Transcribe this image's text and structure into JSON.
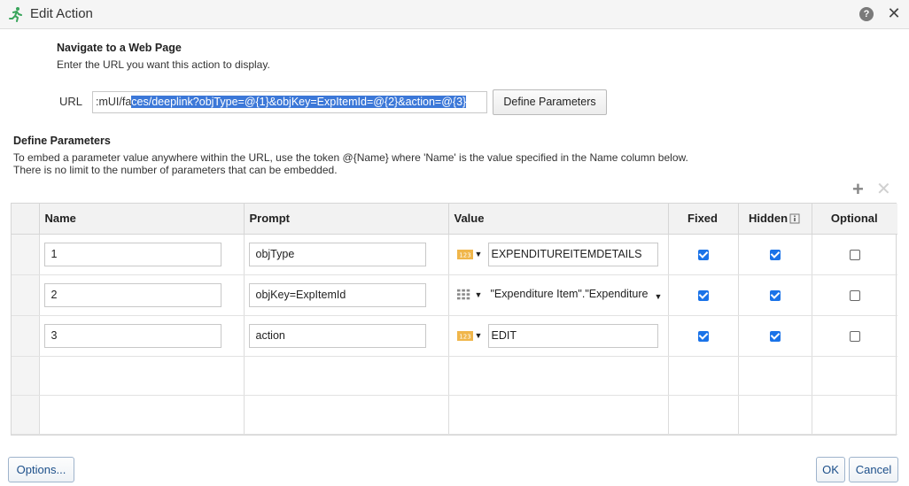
{
  "dialog": {
    "title": "Edit Action"
  },
  "navigate": {
    "heading": "Navigate to a Web Page",
    "description": "Enter the URL you want this action to display."
  },
  "url": {
    "label": "URL",
    "prefix": ":mUI/fa",
    "selected": "ces/deeplink?objType=@{1}&objKey=ExpItemId=@{2}&action=@{3}",
    "define_button": "Define Parameters"
  },
  "define_params": {
    "heading": "Define Parameters",
    "line1": "To embed a parameter value anywhere within the URL, use the token @{Name} where 'Name' is the value specified in the Name column below.",
    "line2": "There is no limit to the number of parameters that can be embedded."
  },
  "table": {
    "columns": {
      "name": "Name",
      "prompt": "Prompt",
      "value": "Value",
      "fixed": "Fixed",
      "hidden": "Hidden",
      "optional": "Optional"
    },
    "rows": [
      {
        "name": "1",
        "prompt": "objType",
        "value_type": "numeric-type-icon",
        "value": "EXPENDITUREITEMDETAILS",
        "fixed": true,
        "hidden": true,
        "optional": false
      },
      {
        "name": "2",
        "prompt": "objKey=ExpItemId",
        "value_type": "column-type-icon",
        "value": "\"Expenditure Item\".\"Expenditure",
        "fixed": true,
        "hidden": true,
        "optional": false
      },
      {
        "name": "3",
        "prompt": "action",
        "value_type": "numeric-type-icon",
        "value": "EDIT",
        "fixed": true,
        "hidden": true,
        "optional": false
      }
    ]
  },
  "footer": {
    "options": "Options...",
    "ok": "OK",
    "cancel": "Cancel"
  },
  "colors": {
    "accent": "#1a73e8",
    "selection": "#3c78d8",
    "button_text": "#1c4f8a"
  }
}
